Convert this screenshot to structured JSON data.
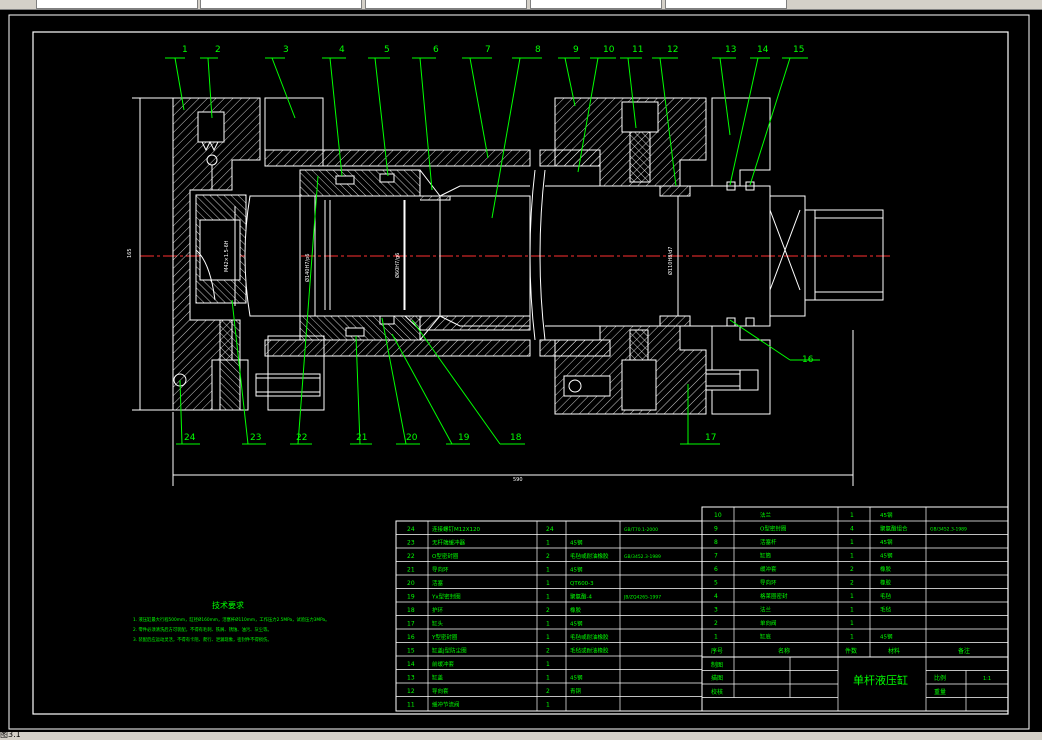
{
  "status_text": "图3.1",
  "balloons": [
    "1",
    "2",
    "3",
    "4",
    "5",
    "6",
    "7",
    "8",
    "9",
    "10",
    "11",
    "12",
    "13",
    "14",
    "15",
    "16",
    "17",
    "18",
    "19",
    "20",
    "21",
    "22",
    "23",
    "24"
  ],
  "dims": {
    "overall_width": "590",
    "height": "165",
    "bore1": "Ø140H7/p6",
    "bore2": "Ø60H7/g6",
    "bore3": "Ø160H7/g6",
    "bore4": "Ø110H8/d7",
    "thread": "M42×1.5-6H"
  },
  "notes": {
    "title": "技术要求",
    "lines": [
      "1. 液压缸最大行程500mm，缸径Ø160mm，活塞杆Ø110mm，工作压力2.5MPa，试验压力3MPa。",
      "2. 零件必须清洗后方可装配，不得有毛刺、铁屑、锈蚀、油污、灰尘等。",
      "3. 装配后应运动灵活，不得有卡阻、爬行、泄漏现象，密封件不得损伤。"
    ]
  },
  "bom_headers": {
    "no": "序号",
    "name": "名称",
    "qty": "件数",
    "material": "材料",
    "remark": "备注"
  },
  "bom_left": [
    {
      "no": "24",
      "name": "连接螺钉M12X120",
      "qty": "24",
      "material": "",
      "remark": "GB/T70.1-2000"
    },
    {
      "no": "23",
      "name": "无杆端缓冲器",
      "qty": "1",
      "material": "45钢",
      "remark": ""
    },
    {
      "no": "22",
      "name": "O型密封圈",
      "qty": "2",
      "material": "毛毡或耐油橡胶",
      "remark": "GB/3452.3-1989"
    },
    {
      "no": "21",
      "name": "导向环",
      "qty": "1",
      "material": "45钢",
      "remark": ""
    },
    {
      "no": "20",
      "name": "活塞",
      "qty": "1",
      "material": "QT600-3",
      "remark": ""
    },
    {
      "no": "19",
      "name": "Yx型密封圈",
      "qty": "1",
      "material": "聚氨酯-4",
      "remark": "JB/ZQ4265-1997"
    },
    {
      "no": "18",
      "name": "护环",
      "qty": "2",
      "material": "橡胶",
      "remark": ""
    },
    {
      "no": "17",
      "name": "缸头",
      "qty": "1",
      "material": "45钢",
      "remark": ""
    },
    {
      "no": "16",
      "name": "Y型密封圈",
      "qty": "1",
      "material": "毛毡或耐油橡胶",
      "remark": ""
    },
    {
      "no": "15",
      "name": "缸盖J型防尘圈",
      "qty": "2",
      "material": "毛毡或耐油橡胶",
      "remark": ""
    },
    {
      "no": "14",
      "name": "前缓冲套",
      "qty": "1",
      "material": "",
      "remark": ""
    },
    {
      "no": "13",
      "name": "缸盖",
      "qty": "1",
      "material": "45钢",
      "remark": ""
    },
    {
      "no": "12",
      "name": "导向套",
      "qty": "2",
      "material": "青铜",
      "remark": ""
    },
    {
      "no": "11",
      "name": "缓冲节流阀",
      "qty": "1",
      "material": "",
      "remark": ""
    }
  ],
  "bom_right": [
    {
      "no": "10",
      "name": "法兰",
      "qty": "1",
      "material": "45钢",
      "remark": ""
    },
    {
      "no": "9",
      "name": "O型密封圈",
      "qty": "4",
      "material": "聚氨酯组合",
      "remark": "GB/3452.3-1989"
    },
    {
      "no": "8",
      "name": "活塞杆",
      "qty": "1",
      "material": "45钢",
      "remark": ""
    },
    {
      "no": "7",
      "name": "缸筒",
      "qty": "1",
      "material": "45钢",
      "remark": ""
    },
    {
      "no": "6",
      "name": "缓冲套",
      "qty": "2",
      "material": "橡胶",
      "remark": ""
    },
    {
      "no": "5",
      "name": "导向环",
      "qty": "2",
      "material": "橡胶",
      "remark": ""
    },
    {
      "no": "4",
      "name": "格莱圈密封",
      "qty": "1",
      "material": "毛毡",
      "remark": ""
    },
    {
      "no": "3",
      "name": "法兰",
      "qty": "1",
      "material": "毛毡",
      "remark": ""
    },
    {
      "no": "2",
      "name": "单向阀",
      "qty": "1",
      "material": "",
      "remark": ""
    },
    {
      "no": "1",
      "name": "缸底",
      "qty": "1",
      "material": "45钢",
      "remark": ""
    }
  ],
  "title_block": {
    "drawn": "制图",
    "checked": "描图",
    "approved": "校核",
    "title": "单杆液压缸",
    "scale_label": "比例",
    "scale_value": "1:1",
    "weight_label": "重量"
  }
}
